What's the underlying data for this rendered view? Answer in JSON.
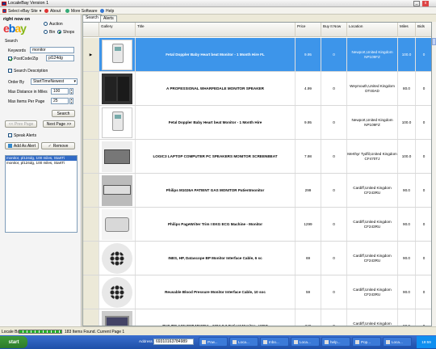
{
  "window": {
    "title": "LocaleBay Version 1"
  },
  "menu": {
    "items": [
      {
        "label": "Select eBay Site",
        "icon": "flag-icon"
      },
      {
        "label": "About",
        "icon": "info-icon"
      },
      {
        "label": "More Software",
        "icon": "globe-icon"
      },
      {
        "label": "Help",
        "icon": "help-icon"
      }
    ]
  },
  "sidebar": {
    "tagline": "right now on",
    "logo": "ebay",
    "location_options": [
      "Auction",
      "Bin",
      "Shops"
    ],
    "search_heading": "Search",
    "keywords_label": "Keywords",
    "keywords_value": "monitor",
    "postcode_label": "PostCode/Zip",
    "postcode_value": "pl124dg",
    "search_description_label": "Search Description",
    "order_by_label": "Order By",
    "order_by_value": "StartTimeNewest",
    "max_distance_label": "Max Distance in Miles",
    "max_distance_value": "100",
    "max_items_label": "Max Items Per Page",
    "max_items_value": "25",
    "search_button": "Search",
    "prev_button": "<< Prev Page",
    "next_button": "Next Page >>",
    "speak_alerts_label": "Speak Alerts",
    "add_alert_button": "Add As Alert",
    "remove_button": "Remove",
    "alerts": [
      "monitor, pl124dg, 100 miles, StartTi",
      "monitor, pl124dg, 100 miles, StartTi"
    ]
  },
  "tabs": [
    "Search",
    "Alerts"
  ],
  "table": {
    "columns": [
      "Gallery",
      "Title",
      "Price",
      "Buy It Now",
      "Location",
      "Miles",
      "Bids"
    ],
    "rows": [
      {
        "title": "Fetal Doppler Baby Heart beat Monitor - 1 Month Hire FL",
        "price": "9.95",
        "bin": "0",
        "location": "Newport,United Kingdom NP109FZ",
        "miles": "100.0",
        "bids": "0",
        "thumb": "doppler"
      },
      {
        "title": "A PROFESSIONAL WHARFEDALE MONITOR SPEAKER",
        "price": "4.99",
        "bin": "0",
        "location": "Weymouth,United Kingdom DT40AD",
        "miles": "80.0",
        "bids": "0",
        "thumb": "speaker"
      },
      {
        "title": "Fetal Doppler Baby Heart beat Monitor - 1 Month Hire",
        "price": "9.95",
        "bin": "0",
        "location": "Newport,United Kingdom NP109FZ",
        "miles": "100.0",
        "bids": "0",
        "thumb": "doppler"
      },
      {
        "title": "LOGIC3 LAPTOP COMPUTER PC SPEAKERS MONITOR SCREENBEAT",
        "price": "7.98",
        "bin": "0",
        "location": "Merthyr Tydfil,United Kingdom CF470TJ",
        "miles": "100.0",
        "bids": "0",
        "thumb": "laptop"
      },
      {
        "title": "Philips M1026A PATIENT GAS MONITOR Patientmonitor",
        "price": "299",
        "bin": "0",
        "location": "Cardiff,United Kingdom CF243RU",
        "miles": "90.0",
        "bids": "0",
        "thumb": "rack"
      },
      {
        "title": "Philips PageWriter Trim I EKG ECG Machine - Monitor",
        "price": "1299",
        "bin": "0",
        "location": "Cardiff,United Kingdom CF243RU",
        "miles": "90.0",
        "bids": "0",
        "thumb": "ecg"
      },
      {
        "title": "INES, HP, Datascope BP Monitor Interface Cable, 6 sc",
        "price": "69",
        "bin": "0",
        "location": "Cardiff,United Kingdom CF243RU",
        "miles": "90.0",
        "bids": "0",
        "thumb": "connector"
      },
      {
        "title": "Reusable Blood Pressure Monitor Interface Cable, 10 soc",
        "price": "59",
        "bin": "0",
        "location": "Cardiff,United Kingdom CF243RU",
        "miles": "90.0",
        "bids": "0",
        "thumb": "connector"
      },
      {
        "title": "PHILIPS AGILENT M1205A - 1204 C.0 Patient Monitor - V26C",
        "price": "349",
        "bin": "0",
        "location": "Cardiff,United Kingdom CF243RU",
        "miles": "90.0",
        "bids": "0",
        "thumb": "monitor"
      }
    ]
  },
  "status": {
    "app": "Locale Bay",
    "progress_fraction": 1.0,
    "message": "183 Items Found. Current Page 1"
  },
  "taskbar": {
    "start": "start",
    "address_label": "Address",
    "address_value": "69310163784989",
    "buttons": [
      "Pow...",
      "Loca...",
      "Inbo...",
      "Loca...",
      "help...",
      "Pop...",
      "Loca..."
    ],
    "clock": "19:59"
  },
  "colors": {
    "selected_row": "#3d95ea",
    "ebay_e": "#e53238",
    "ebay_b": "#0064d2",
    "ebay_a": "#f5af02",
    "ebay_y": "#86b817"
  }
}
